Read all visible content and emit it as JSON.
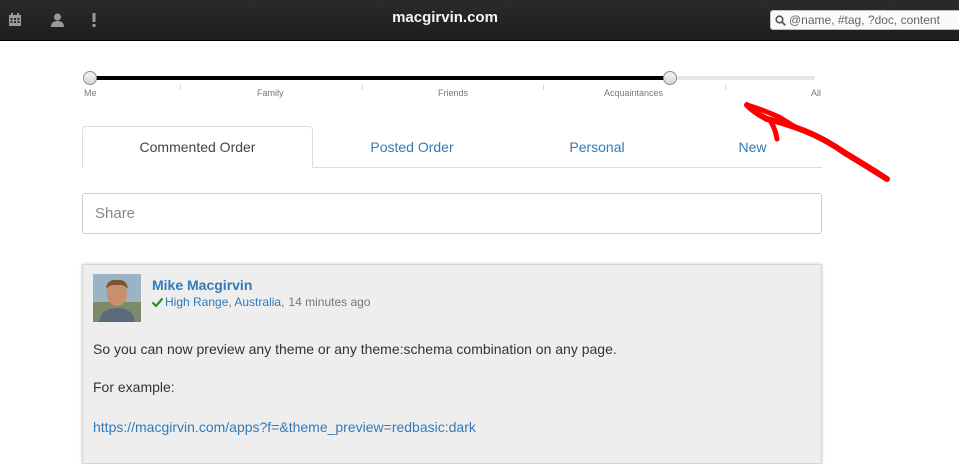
{
  "navbar": {
    "brand": "macgirvin.com",
    "icons": [
      "calendar-icon",
      "user-icon",
      "exclamation-icon"
    ],
    "search_placeholder": "@name, #tag, ?doc, content"
  },
  "slider": {
    "value_fraction": 0.8,
    "labels": [
      "Me",
      "Family",
      "Friends",
      "Acquaintances",
      "All"
    ]
  },
  "tabs": [
    {
      "label": "Commented Order",
      "active": true
    },
    {
      "label": "Posted Order",
      "active": false
    },
    {
      "label": "Personal",
      "active": false
    },
    {
      "label": "New",
      "active": false
    }
  ],
  "share": {
    "placeholder": "Share"
  },
  "post": {
    "author": "Mike Macgirvin",
    "location": "High Range, Australia",
    "separator": ",",
    "time": "14 minutes ago",
    "paragraphs": [
      "So you can now preview any theme or any theme:schema combination on any page.",
      "For example:"
    ],
    "link": "https://macgirvin.com/apps?f=&theme_preview=redbasic:dark"
  },
  "annotation": {
    "color": "#ff0000"
  }
}
